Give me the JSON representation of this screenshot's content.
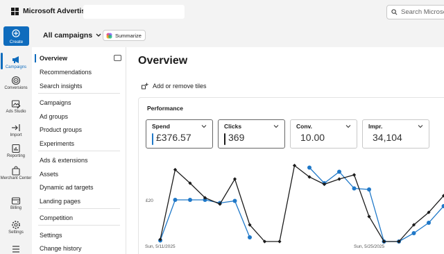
{
  "app": {
    "brand": "Microsoft Advertising",
    "search_placeholder": "Search Microsoft"
  },
  "rail": {
    "create_label": "Create",
    "items": [
      {
        "label": "Campaigns",
        "icon": "megaphone-icon",
        "active": true
      },
      {
        "label": "Conversions",
        "icon": "target-icon"
      },
      {
        "label": "Ads Studio",
        "icon": "image-edit-icon"
      },
      {
        "label": "Import",
        "icon": "import-arrow-icon"
      },
      {
        "label": "Reporting",
        "icon": "report-chart-icon"
      },
      {
        "label": "Merchant Center",
        "icon": "store-bag-icon"
      },
      {
        "label": "Billing",
        "icon": "wallet-icon"
      },
      {
        "label": "Settings",
        "icon": "gear-icon"
      },
      {
        "label": "",
        "icon": "list-icon"
      }
    ]
  },
  "subheader": {
    "scope_label": "All campaigns",
    "summarize_label": "Summarize"
  },
  "nav": {
    "items": [
      "Overview",
      "Recommendations",
      "Search insights",
      "Campaigns",
      "Ad groups",
      "Product groups",
      "Experiments",
      "Ads & extensions",
      "Assets",
      "Dynamic ad targets",
      "Landing pages",
      "Competition",
      "Settings",
      "Change history"
    ],
    "active_index": 0
  },
  "main": {
    "title": "Overview",
    "tiles_link": "Add or remove tiles",
    "performance": {
      "title": "Performance",
      "metrics": [
        {
          "name": "Spend",
          "value": "£376.57",
          "selected": true,
          "color": "#1f78c8"
        },
        {
          "name": "Clicks",
          "value": "369",
          "selected": true,
          "color": "#1b1b1b"
        },
        {
          "name": "Conv.",
          "value": "10.00",
          "selected": false
        },
        {
          "name": "Impr.",
          "value": "34,104",
          "selected": false
        }
      ]
    }
  },
  "chart_data": {
    "type": "line",
    "y_tick_label": "£20",
    "y_tick_value": 20,
    "y_min": 0,
    "y_max": 38,
    "x_tick_labels": [
      {
        "index": 0,
        "label": "Sun, 5/11/2025"
      },
      {
        "index": 14,
        "label": "Sun, 5/25/2025"
      }
    ],
    "series": [
      {
        "name": "Spend",
        "color": "#1f78c8",
        "values": [
          0.5,
          20,
          20,
          20,
          18.5,
          19.5,
          2,
          null,
          null,
          null,
          35.5,
          28,
          33.5,
          25.5,
          25,
          0,
          0,
          4,
          9,
          17,
          33,
          24,
          23
        ]
      },
      {
        "name": "Clicks",
        "color": "#1b1b1b",
        "values": [
          1,
          34.5,
          28,
          21,
          18,
          30,
          8,
          0,
          0,
          36.5,
          31,
          27.5,
          30,
          32,
          12,
          0,
          0,
          8,
          14,
          22,
          35,
          32,
          30
        ]
      }
    ]
  }
}
